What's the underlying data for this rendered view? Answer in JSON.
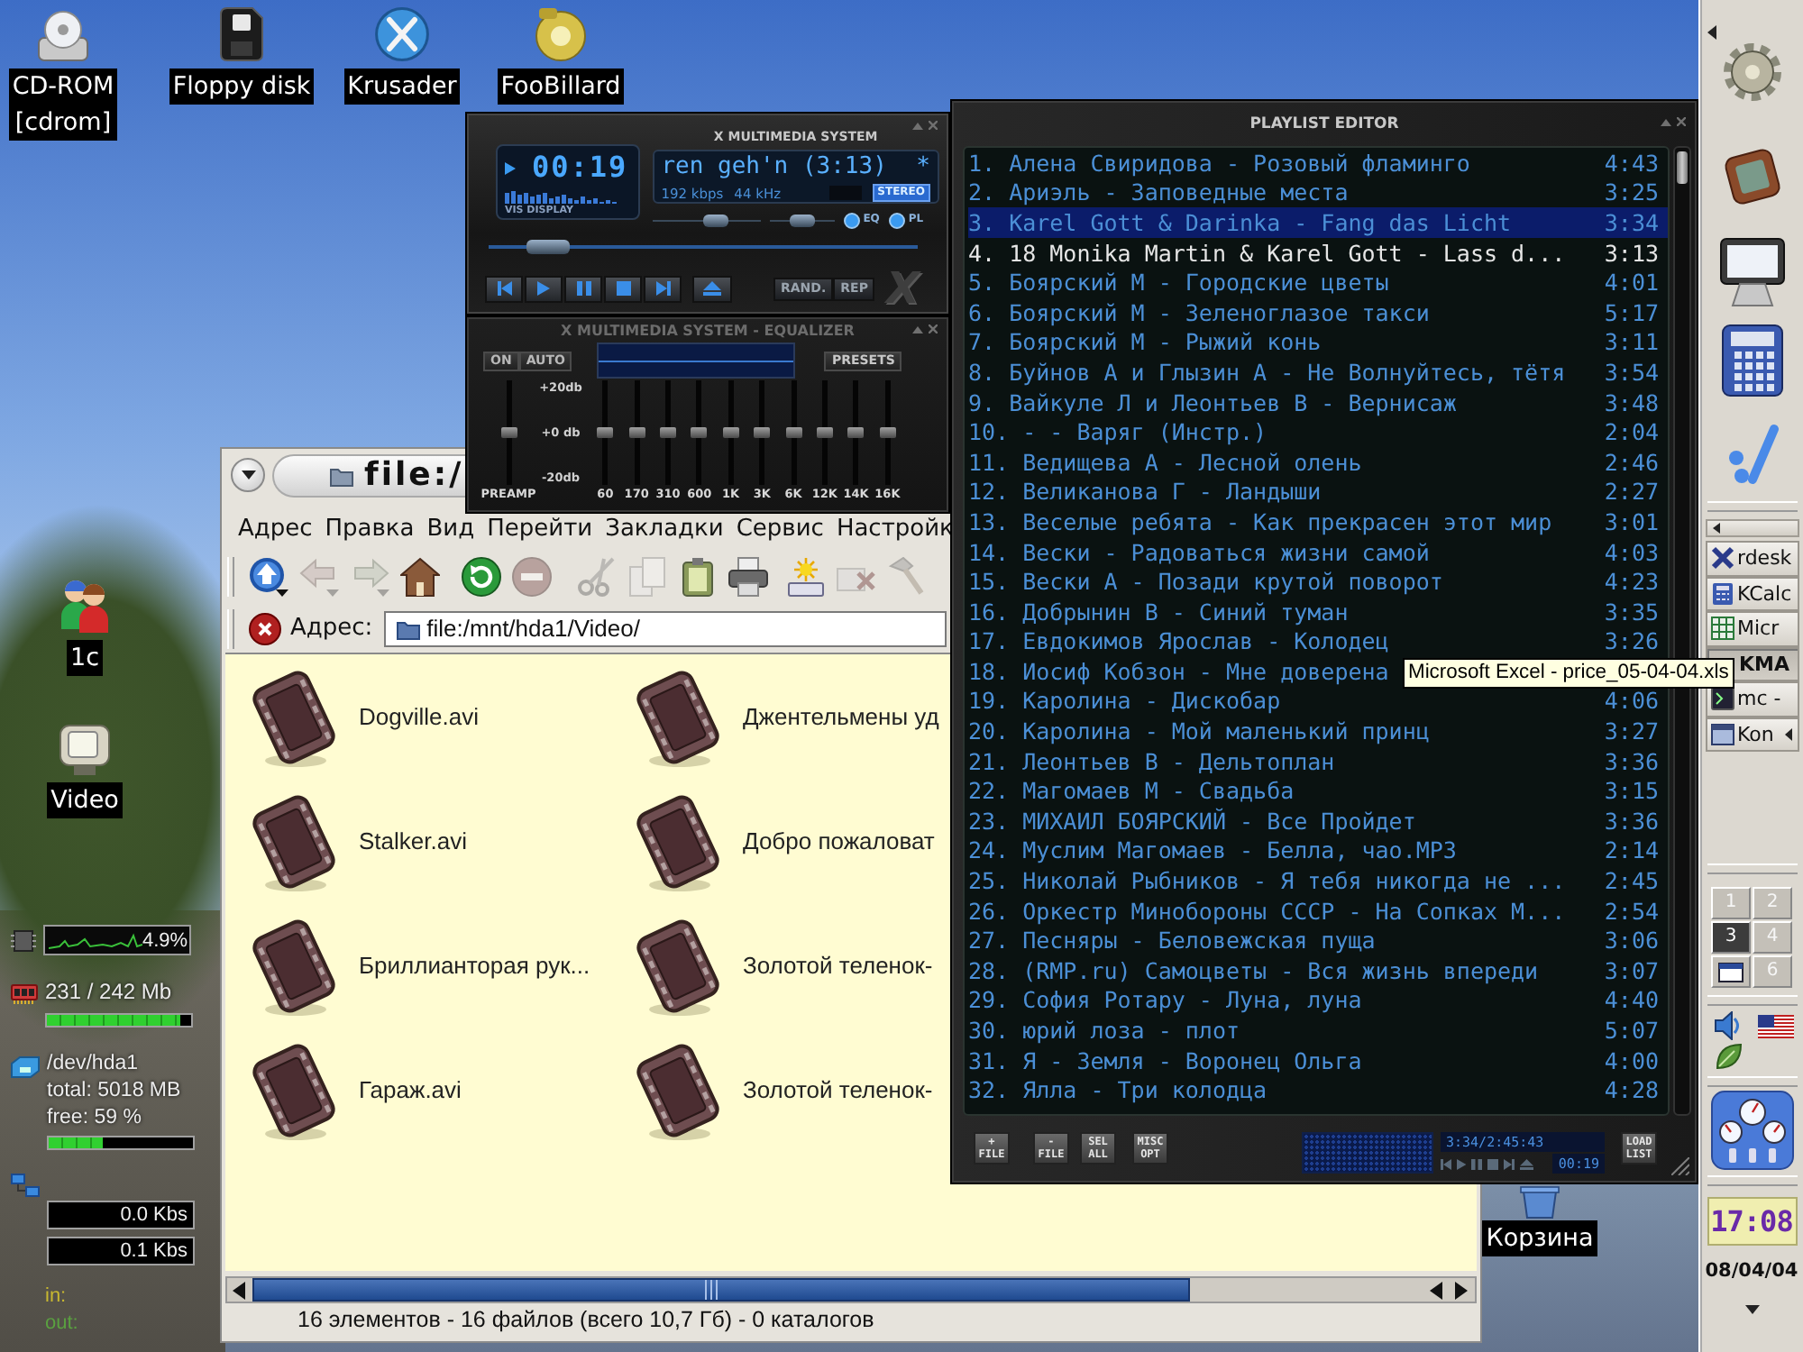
{
  "desktop": {
    "icons": [
      {
        "kind": "cdrom",
        "label": "CD-ROM\n[cdrom]"
      },
      {
        "kind": "floppy",
        "label": "Floppy disk"
      },
      {
        "kind": "krusader",
        "label": "Krusader"
      },
      {
        "kind": "billiard",
        "label": "FooBillard"
      },
      {
        "kind": "users",
        "label": "1c"
      },
      {
        "kind": "tv",
        "label": "Video"
      },
      {
        "kind": "trash",
        "label": "Корзина"
      }
    ]
  },
  "monitor": {
    "cpu": {
      "reading": "4.9%"
    },
    "memory": {
      "reading": "231 / 242 Mb",
      "level": 0.93
    },
    "disk": {
      "lines": [
        "/dev/hda1",
        "total: 5018 MB",
        "free: 59 %"
      ],
      "level": 0.37
    },
    "network": {
      "rates": [
        "0.0 Kbs",
        "0.1 Kbs"
      ],
      "legend": [
        "in:",
        "out:"
      ]
    }
  },
  "player": {
    "title": "X MULTIMEDIA SYSTEM",
    "time": "00:19",
    "vis_label": "VIS DISPLAY",
    "song": "ren geh'n (3:13)",
    "marker": "*",
    "bitrate": "192 kbps",
    "samplerate": "44 kHz",
    "stereo": {
      "label": "STEREO",
      "on": true
    },
    "volume": {
      "level": 0.62
    },
    "balance": {
      "level": 0.5
    },
    "toggles": [
      {
        "label": "EQ",
        "on": true
      },
      {
        "label": "PL",
        "on": true
      }
    ],
    "seek": {
      "level": 0.1
    },
    "modes": [
      {
        "label": "RAND.",
        "on": false
      },
      {
        "label": "REP",
        "on": false
      }
    ],
    "logo": "X"
  },
  "equalizer": {
    "title": "X MULTIMEDIA SYSTEM - EQUALIZER",
    "switches": [
      {
        "label": "ON",
        "on": false
      },
      {
        "label": "AUTO",
        "on": false
      }
    ],
    "presets": "PRESETS",
    "scale": [
      "+20db",
      "+0 db",
      "-20db"
    ],
    "preamp": {
      "label": "PREAMP",
      "level": 0.5
    },
    "bands": [
      {
        "label": "60",
        "level": 0.5
      },
      {
        "label": "170",
        "level": 0.5
      },
      {
        "label": "310",
        "level": 0.5
      },
      {
        "label": "600",
        "level": 0.5
      },
      {
        "label": "1K",
        "level": 0.5
      },
      {
        "label": "3K",
        "level": 0.5
      },
      {
        "label": "6K",
        "level": 0.5
      },
      {
        "label": "12K",
        "level": 0.5
      },
      {
        "label": "14K",
        "level": 0.5
      },
      {
        "label": "16K",
        "level": 0.5
      }
    ]
  },
  "playlist": {
    "title": "PLAYLIST EDITOR",
    "rows": [
      {
        "title": "1. Алена Свиридова - Розовый фламинго",
        "time": "4:43",
        "selected": false,
        "playing": false
      },
      {
        "title": "2. Ариэль - Заповедные места",
        "time": "3:25",
        "selected": false,
        "playing": false
      },
      {
        "title": "3. Karel Gott & Darinka - Fang das Licht",
        "time": "3:34",
        "selected": true,
        "playing": false
      },
      {
        "title": "4. 18 Monika Martin & Karel Gott - Lass d...",
        "time": "3:13",
        "selected": false,
        "playing": true
      },
      {
        "title": "5. Боярский М - Городские цветы",
        "time": "4:01",
        "selected": false,
        "playing": false
      },
      {
        "title": "6. Боярский М - Зеленоглазое такси",
        "time": "5:17",
        "selected": false,
        "playing": false
      },
      {
        "title": "7. Боярский М - Рыжий конь",
        "time": "3:11",
        "selected": false,
        "playing": false
      },
      {
        "title": "8. Буйнов А и Глызин А - Не Волнуйтесь, тётя",
        "time": "3:54",
        "selected": false,
        "playing": false
      },
      {
        "title": "9. Вайкуле Л и Леонтьев В - Вернисаж",
        "time": "3:48",
        "selected": false,
        "playing": false
      },
      {
        "title": "10. - - Варяг (Инстр.)",
        "time": "2:04",
        "selected": false,
        "playing": false
      },
      {
        "title": "11. Ведищева А - Лесной олень",
        "time": "2:46",
        "selected": false,
        "playing": false
      },
      {
        "title": "12. Великанова Г - Ландыши",
        "time": "2:27",
        "selected": false,
        "playing": false
      },
      {
        "title": "13. Веселые ребята - Как прекрасен этот мир",
        "time": "3:01",
        "selected": false,
        "playing": false
      },
      {
        "title": "14. Вески - Радоваться жизни самой",
        "time": "4:03",
        "selected": false,
        "playing": false
      },
      {
        "title": "15. Вески А - Позади крутой поворот",
        "time": "4:23",
        "selected": false,
        "playing": false
      },
      {
        "title": "16. Добрынин В - Синий туман",
        "time": "3:35",
        "selected": false,
        "playing": false
      },
      {
        "title": "17. Евдокимов Ярослав - Колодец",
        "time": "3:26",
        "selected": false,
        "playing": false
      },
      {
        "title": "18. Иосиф Кобзон - Мне доверена",
        "selected": false,
        "playing": false
      },
      {
        "title": "19. Каролина - Дискобар",
        "time": "4:06",
        "selected": false,
        "playing": false
      },
      {
        "title": "20. Каролина - Мой маленький принц",
        "time": "3:27",
        "selected": false,
        "playing": false
      },
      {
        "title": "21. Леонтьев В - Дельтоплан",
        "time": "3:36",
        "selected": false,
        "playing": false
      },
      {
        "title": "22. Магомаев М - Свадьба",
        "time": "3:15",
        "selected": false,
        "playing": false
      },
      {
        "title": "23. МИХАИЛ БОЯРСКИЙ - Все Пройдет",
        "time": "3:36",
        "selected": false,
        "playing": false
      },
      {
        "title": "24. Муслим Магомаев - Белла, чао.MP3",
        "time": "2:14",
        "selected": false,
        "playing": false
      },
      {
        "title": "25. Николай Рыбников - Я тебя никогда не ...",
        "time": "2:45",
        "selected": false,
        "playing": false
      },
      {
        "title": "26. Оркестр Минобороны СССР - На Сопках М...",
        "time": "2:54",
        "selected": false,
        "playing": false
      },
      {
        "title": "27. Песняры - Беловежская пуща",
        "time": "3:06",
        "selected": false,
        "playing": false
      },
      {
        "title": "28. (RMP.ru) Самоцветы - Вся жизнь впереди",
        "time": "3:07",
        "selected": false,
        "playing": false
      },
      {
        "title": "29. София Ротару - Луна, луна",
        "time": "4:40",
        "selected": false,
        "playing": false
      },
      {
        "title": "30. юрий лоза - плот",
        "time": "5:07",
        "selected": false,
        "playing": false
      },
      {
        "title": "31. Я - Земля - Воронец Ольга",
        "time": "4:00",
        "selected": false,
        "playing": false
      },
      {
        "title": "32. Ялла - Три колодца",
        "time": "4:28",
        "selected": false,
        "playing": false
      }
    ],
    "buttons": [
      "+\nFILE",
      "-\nFILE",
      "SEL\nALL",
      "MISC\nOPT"
    ],
    "total_time": "3:34/2:45:43",
    "elapsed": "00:19",
    "load_button": "LOAD\nLIST"
  },
  "tooltip": "Microsoft Excel - price_05-04-04.xls",
  "file_manager": {
    "title": "file:/",
    "menu": [
      "Адрес",
      "Правка",
      "Вид",
      "Перейти",
      "Закладки",
      "Сервис",
      "Настройк"
    ],
    "toolbar": [
      {
        "kind": "up",
        "disabled": false
      },
      {
        "kind": "back",
        "disabled": true
      },
      {
        "kind": "forward",
        "disabled": true
      },
      {
        "kind": "home",
        "disabled": false
      },
      {
        "kind": "reload",
        "disabled": false
      },
      {
        "kind": "stop",
        "disabled": true
      },
      {
        "kind": "cut",
        "disabled": true
      },
      {
        "kind": "copy",
        "disabled": true
      },
      {
        "kind": "paste",
        "disabled": false
      },
      {
        "kind": "print",
        "disabled": false
      },
      {
        "kind": "new",
        "disabled": false
      },
      {
        "kind": "delete",
        "disabled": true
      },
      {
        "kind": "tool",
        "disabled": true
      }
    ],
    "address_label": "Адрес:",
    "address": "file:/mnt/hda1/Video/",
    "files": [
      "Dogville.avi",
      "Джентельмены уд",
      "Stalker.avi",
      "Добро пожаловат",
      "Бриллианторая рук...",
      "Золотой теленок-",
      "Гараж.avi",
      "Золотой теленок-"
    ],
    "status": "16 элементов - 16 файлов (всего 10,7 Гб) - 0 каталогов"
  },
  "panel": {
    "tasks": [
      {
        "kind": "remote",
        "label": "rdesk",
        "selected": false,
        "grouped": false
      },
      {
        "kind": "calculator",
        "label": "KCalc",
        "selected": false,
        "grouped": false
      },
      {
        "kind": "spreadsheet",
        "label": "Micr",
        "selected": false,
        "grouped": false
      },
      {
        "label": "KMA",
        "selected": true,
        "grouped": false
      },
      {
        "kind": "terminal",
        "label": "mc -",
        "selected": false,
        "grouped": false
      },
      {
        "kind": "browser",
        "label": "Kon",
        "selected": false,
        "grouped": true
      }
    ],
    "desktops": [
      {
        "label": "1",
        "selected": false,
        "window": false
      },
      {
        "label": "2",
        "selected": false,
        "window": false
      },
      {
        "label": "3",
        "selected": true,
        "window": false
      },
      {
        "label": "4",
        "selected": false,
        "window": false
      },
      {
        "selected": false,
        "window": true
      },
      {
        "label": "6",
        "selected": false,
        "window": false
      }
    ],
    "clock": {
      "time": "17:08",
      "date": "08/04/04"
    }
  }
}
